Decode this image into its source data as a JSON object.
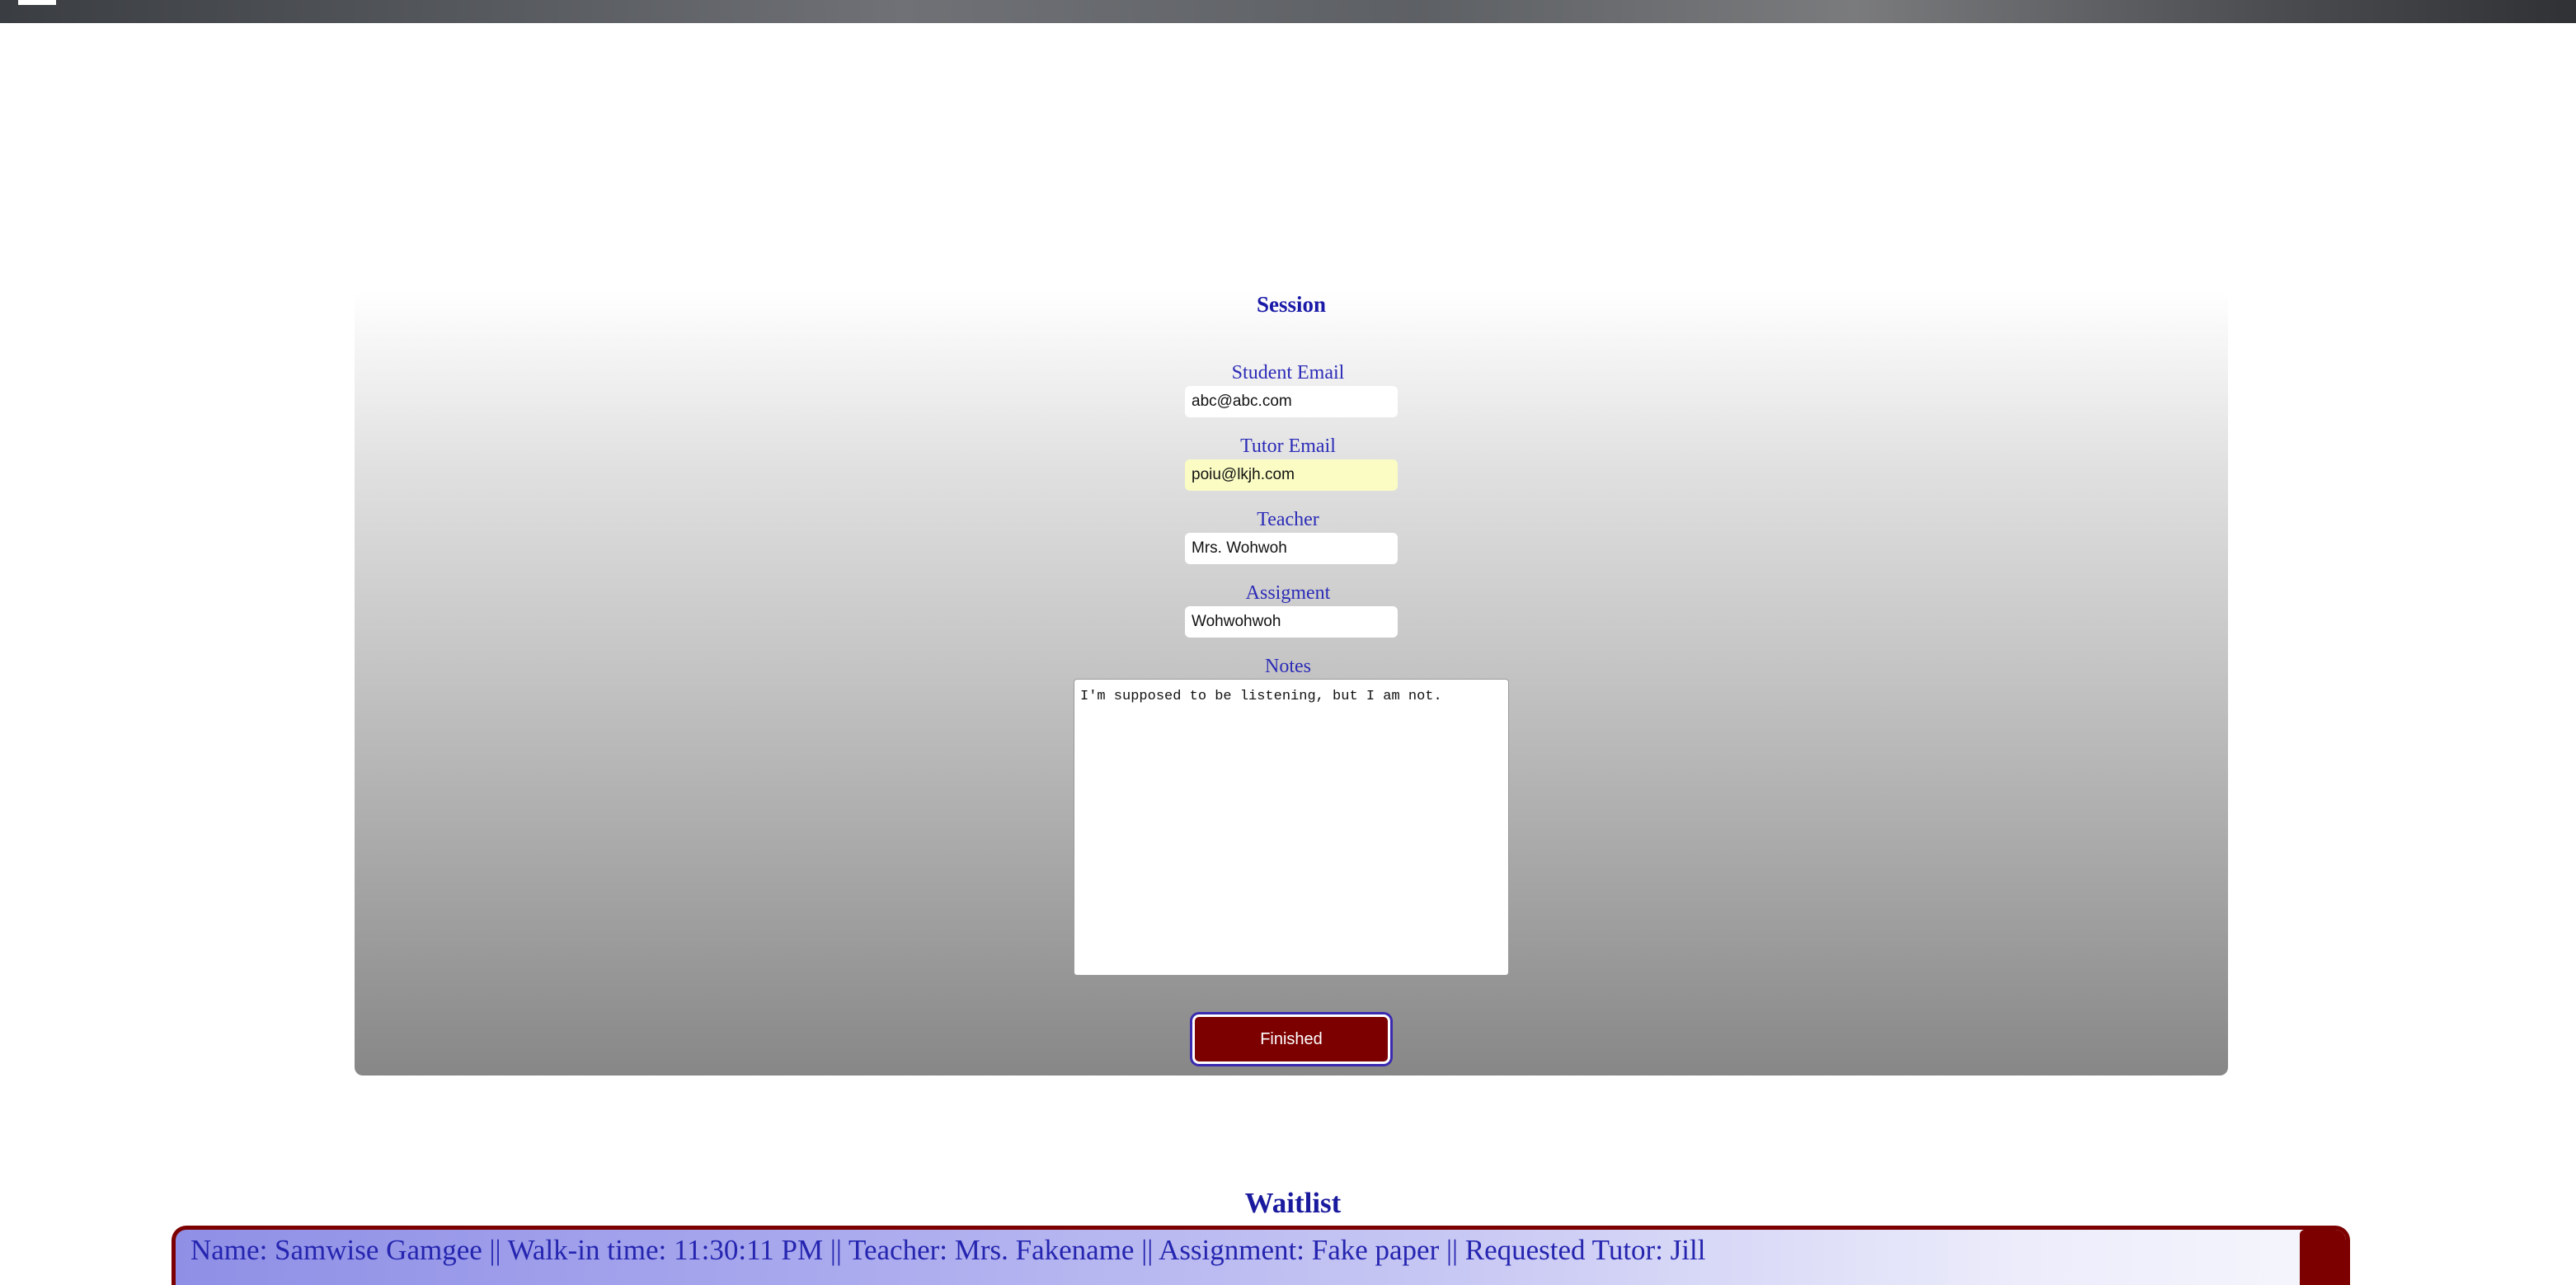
{
  "session": {
    "title": "Session",
    "fields": {
      "student_email": {
        "label": "Student Email",
        "value": "abc@abc.com"
      },
      "tutor_email": {
        "label": "Tutor Email",
        "value": "poiu@lkjh.com"
      },
      "teacher": {
        "label": "Teacher",
        "value": "Mrs. Wohwoh"
      },
      "assignment": {
        "label": "Assigment",
        "value": "Wohwohwoh"
      },
      "notes": {
        "label": "Notes",
        "value": "I'm supposed to be listening, but I am not."
      }
    },
    "finished_label": "Finished"
  },
  "waitlist": {
    "title": "Waitlist",
    "entries": [
      {
        "text": "Name: Samwise Gamgee || Walk-in time: 11:30:11 PM || Teacher: Mrs. Fakename || Assignment: Fake paper || Requested Tutor: Jill"
      }
    ]
  },
  "colors": {
    "accent_blue": "#1a1aa8",
    "button_maroon": "#7d0000",
    "autofill_yellow": "#fafcc3"
  },
  "icons": {
    "menu": "menu-icon"
  }
}
